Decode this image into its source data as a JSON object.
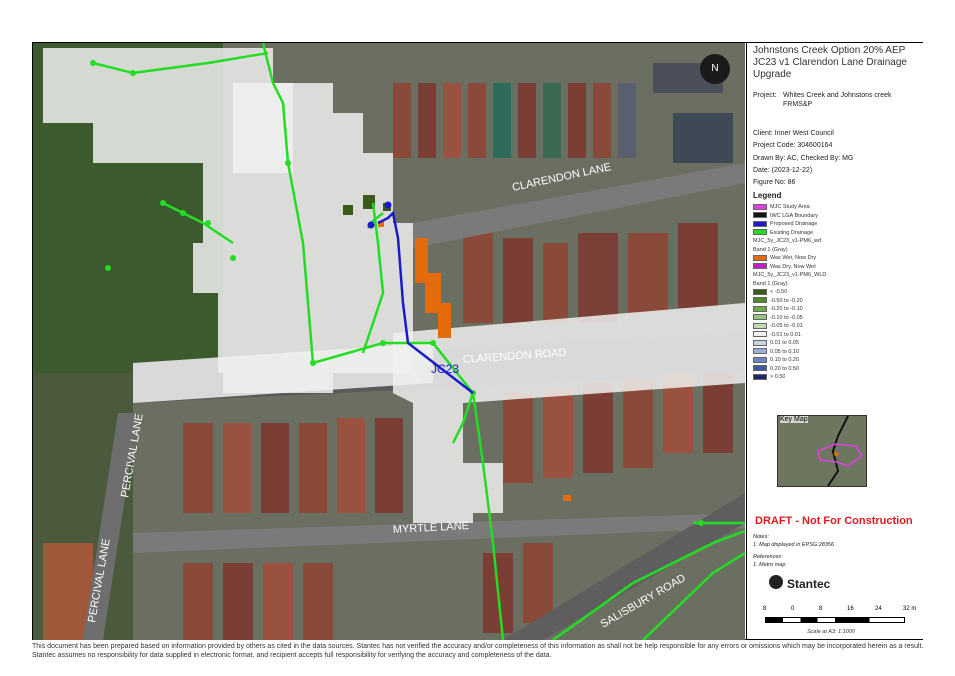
{
  "title": "Johnstons Creek Option 20% AEP JC23 v1 Clarendon Lane Drainage Upgrade",
  "project_label": "Project:",
  "project_value": "Whites Creek and Johnstons creek FRMS&P",
  "client": "Client:  Inner West Council",
  "project_code": "Project Code:  304600164",
  "drawn_by": "Drawn By:  AC, Checked By: MG",
  "date": "Date:  (2023-12-22)",
  "figure_no": "Figure No:  86",
  "legend_title": "Legend",
  "legend": [
    {
      "label": "MJC Study Area",
      "color": "#e040e0"
    },
    {
      "label": "IWC LGA Boundary",
      "color": "#111111"
    },
    {
      "label": "Proposed Drainage",
      "color": "#1a1acc"
    },
    {
      "label": "Existing Drainage",
      "color": "#22dd22"
    },
    {
      "label": "MJC_5y_JC23_v1-PM6_wd",
      "color": ""
    },
    {
      "label": "Band 1 (Gray)",
      "color": ""
    },
    {
      "label": "Was Wet, Now Dry",
      "color": "#e46b0c"
    },
    {
      "label": "Was Dry, Now Wet",
      "color": "#c61fc9"
    },
    {
      "label": "MJC_5y_JC23_v1-PM6_WLD",
      "color": ""
    },
    {
      "label": "Band 1 (Gray)",
      "color": ""
    },
    {
      "label": "< -0.50",
      "color": "#3a5a1a"
    },
    {
      "label": "-0.50 to -0.20",
      "color": "#4e8a2a"
    },
    {
      "label": "-0.20 to -0.10",
      "color": "#6aab45"
    },
    {
      "label": "-0.10 to -0.05",
      "color": "#94c67a"
    },
    {
      "label": "-0.05 to -0.01",
      "color": "#bfdcb0"
    },
    {
      "label": "-0.01 to 0.01",
      "color": "#f0f0f0"
    },
    {
      "label": "0.01 to 0.05",
      "color": "#c8d4e8"
    },
    {
      "label": "0.05 to 0.10",
      "color": "#9bb2d8"
    },
    {
      "label": "0.10 to 0.20",
      "color": "#6a88c2"
    },
    {
      "label": "0.20 to 0.50",
      "color": "#3d5aa0"
    },
    {
      "label": "> 0.50",
      "color": "#1a2466"
    }
  ],
  "key_map_label": "Key Map",
  "draft_text": "DRAFT - Not For Construction",
  "notes_title": "Notes:",
  "notes_1": "1. Map displayed in EPSG:28356",
  "references_title": "References:",
  "references_1": "1. Metro map",
  "brand": "Stantec",
  "scale_ticks": [
    "8",
    "0",
    "8",
    "16",
    "24",
    "32 m"
  ],
  "scale_text": "Scale at A3: 1:1000",
  "north": "N",
  "streets": {
    "clarendon_lane": "CLARENDON LANE",
    "clarendon_road": "CLARENDON ROAD",
    "myrtle_lane": "MYRTLE LANE",
    "percival_lane_1": "PERCIVAL LANE",
    "percival_lane_2": "PERCIVAL LANE",
    "salisbury_road": "SALISBURY ROAD",
    "jc23": "JC23"
  },
  "disclaimer": "This document has been prepared based on information provided by others as cited in the data sources. Stantec has not verified the accuracy and/or completeness of this information as shall not be help responsible for any errors or omissions which may be incorporated herein as a result. Stantec assumes no responsibility for data supplied in electronic format, and recipient accepts full responsibility for verifying the accuracy and completeness of the data."
}
